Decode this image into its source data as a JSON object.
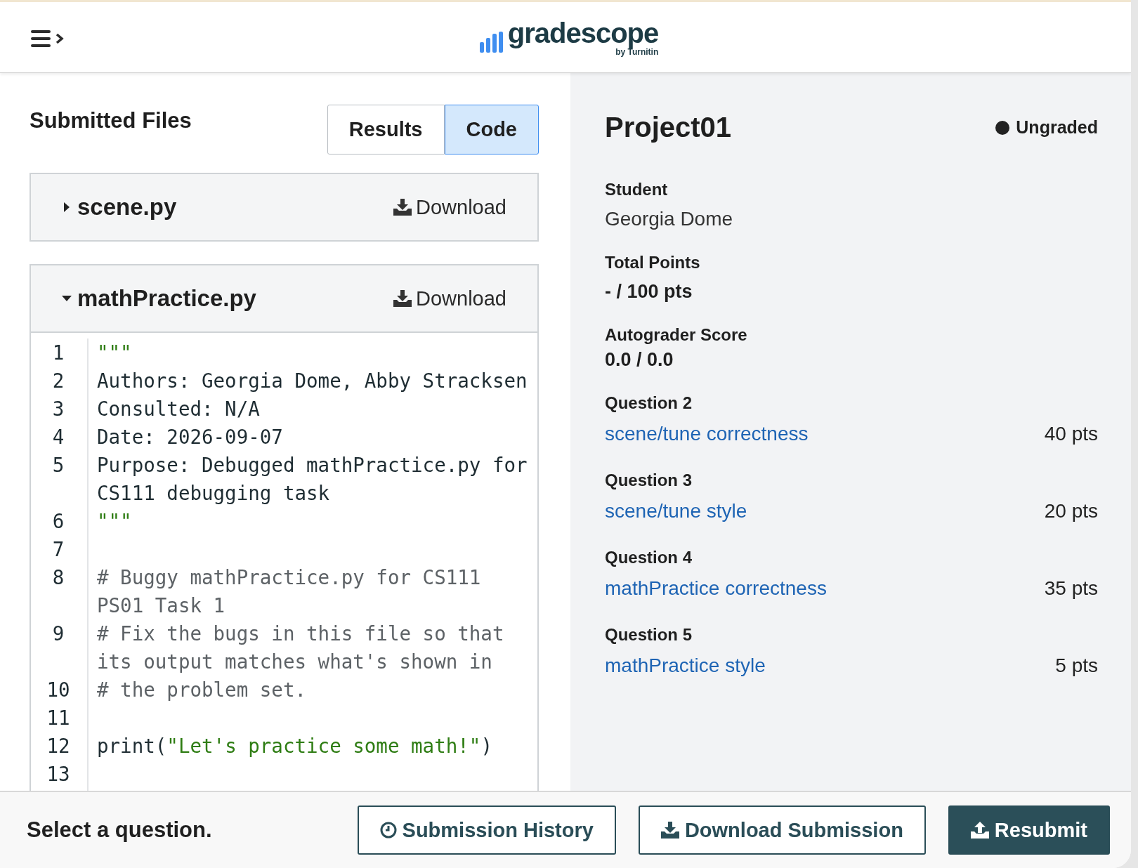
{
  "header": {
    "logo": "gradescope",
    "logo_sub": "by Turnitin"
  },
  "files_panel": {
    "title": "Submitted Files",
    "tabs": [
      {
        "label": "Results",
        "selected": false
      },
      {
        "label": "Code",
        "selected": true
      }
    ],
    "files": [
      {
        "name": "scene.py",
        "expanded": false,
        "download": "Download"
      },
      {
        "name": "mathPractice.py",
        "expanded": true,
        "download": "Download",
        "lines": [
          {
            "number": "1",
            "segments": [
              {
                "kind": "string",
                "text": "\"\"\""
              }
            ]
          },
          {
            "number": "2",
            "segments": [
              {
                "kind": "plain",
                "text": "Authors: Georgia Dome, Abby Stracksen"
              }
            ]
          },
          {
            "number": "3",
            "segments": [
              {
                "kind": "plain",
                "text": "Consulted: N/A"
              }
            ]
          },
          {
            "number": "4",
            "segments": [
              {
                "kind": "plain",
                "text": "Date: 2026-09-07"
              }
            ]
          },
          {
            "number": "5",
            "segments": [
              {
                "kind": "plain",
                "text": "Purpose: Debugged mathPractice.py for CS111 debugging task"
              }
            ]
          },
          {
            "number": "6",
            "segments": [
              {
                "kind": "string",
                "text": "\"\"\""
              }
            ]
          },
          {
            "number": "7"
          },
          {
            "number": "8",
            "segments": [
              {
                "kind": "comment",
                "text": "# Buggy mathPractice.py for CS111 PS01 Task 1"
              }
            ]
          },
          {
            "number": "9",
            "segments": [
              {
                "kind": "comment",
                "text": "# Fix the bugs in this file so that its output matches what's shown in"
              }
            ]
          },
          {
            "number": "10",
            "segments": [
              {
                "kind": "comment",
                "text": "# the problem set."
              }
            ]
          },
          {
            "number": "11"
          },
          {
            "number": "12",
            "segments": [
              {
                "kind": "plain",
                "text": "print("
              },
              {
                "kind": "string",
                "text": "\"Let's practice some math!\""
              },
              {
                "kind": "plain",
                "text": ")"
              }
            ]
          },
          {
            "number": "13"
          }
        ]
      }
    ]
  },
  "summary": {
    "title": "Project01",
    "status": "Ungraded",
    "fields": [
      {
        "label": "Student",
        "value": "Georgia Dome",
        "kind": "plain"
      },
      {
        "label": "Total Points",
        "value": "- / 100 pts",
        "kind": "bold"
      },
      {
        "label": "Autograder Score",
        "value": "0.0 / 0.0",
        "kind": "bold"
      }
    ],
    "questions": [
      {
        "label": "Question 2",
        "title": "scene/tune correctness",
        "points": "40 pts"
      },
      {
        "label": "Question 3",
        "title": "scene/tune style",
        "points": "20 pts"
      },
      {
        "label": "Question 4",
        "title": "mathPractice correctness",
        "points": "35 pts"
      },
      {
        "label": "Question 5",
        "title": "mathPractice style",
        "points": "5 pts"
      }
    ]
  },
  "footer": {
    "prompt": "Select a question.",
    "buttons": [
      {
        "label": "Submission History",
        "kind": "history"
      },
      {
        "label": "Download Submission",
        "kind": "download"
      },
      {
        "label": "Resubmit",
        "kind": "resubmit"
      }
    ]
  }
}
